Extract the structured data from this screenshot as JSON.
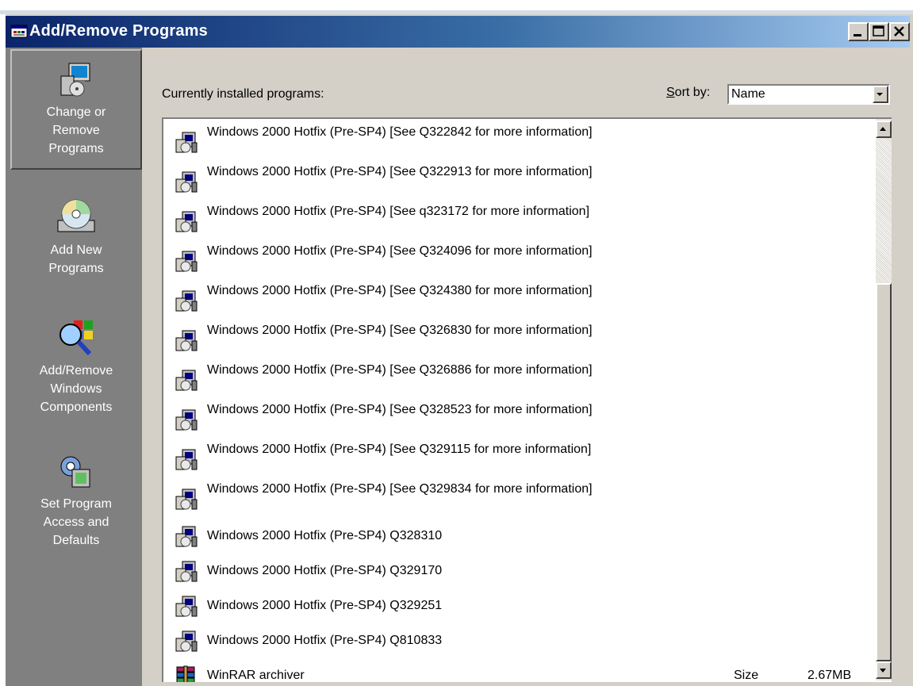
{
  "window": {
    "title": "Add/Remove Programs"
  },
  "sidebar": {
    "items": [
      {
        "label": "Change or\nRemove\nPrograms",
        "icon": "change-remove-programs-icon",
        "active": true
      },
      {
        "label": "Add New\nPrograms",
        "icon": "add-new-programs-icon",
        "active": false
      },
      {
        "label": "Add/Remove\nWindows\nComponents",
        "icon": "windows-components-icon",
        "active": false
      },
      {
        "label": "Set Program\nAccess and\nDefaults",
        "icon": "program-access-defaults-icon",
        "active": false
      }
    ]
  },
  "main": {
    "installed_label": "Currently installed programs:",
    "sort_by_label_prefix": "S",
    "sort_by_label_rest": "ort by:",
    "sort_by_value": "Name",
    "programs": [
      {
        "name": "Windows 2000 Hotfix (Pre-SP4) [See Q322842 for more information]"
      },
      {
        "name": "Windows 2000 Hotfix (Pre-SP4) [See Q322913 for more information]"
      },
      {
        "name": "Windows 2000 Hotfix (Pre-SP4) [See q323172 for more information]"
      },
      {
        "name": "Windows 2000 Hotfix (Pre-SP4) [See Q324096 for more information]"
      },
      {
        "name": "Windows 2000 Hotfix (Pre-SP4) [See Q324380 for more information]"
      },
      {
        "name": "Windows 2000 Hotfix (Pre-SP4) [See Q326830 for more information]"
      },
      {
        "name": "Windows 2000 Hotfix (Pre-SP4) [See Q326886 for more information]"
      },
      {
        "name": "Windows 2000 Hotfix (Pre-SP4) [See Q328523 for more information]"
      },
      {
        "name": "Windows 2000 Hotfix (Pre-SP4) [See Q329115 for more information]"
      },
      {
        "name": "Windows 2000 Hotfix (Pre-SP4) [See Q329834 for more information]"
      },
      {
        "name": "Windows 2000 Hotfix (Pre-SP4) Q328310"
      },
      {
        "name": "Windows 2000 Hotfix (Pre-SP4) Q329170"
      },
      {
        "name": "Windows 2000 Hotfix (Pre-SP4) Q329251"
      },
      {
        "name": "Windows 2000 Hotfix (Pre-SP4) Q810833"
      },
      {
        "name": "WinRAR archiver",
        "size_label": "Size",
        "size_value": "2.67MB"
      }
    ]
  },
  "colors": {
    "titlebar_start": "#0a246a",
    "titlebar_end": "#a6caf0",
    "sidebar_bg": "#808080",
    "window_face": "#d4d0c8"
  }
}
